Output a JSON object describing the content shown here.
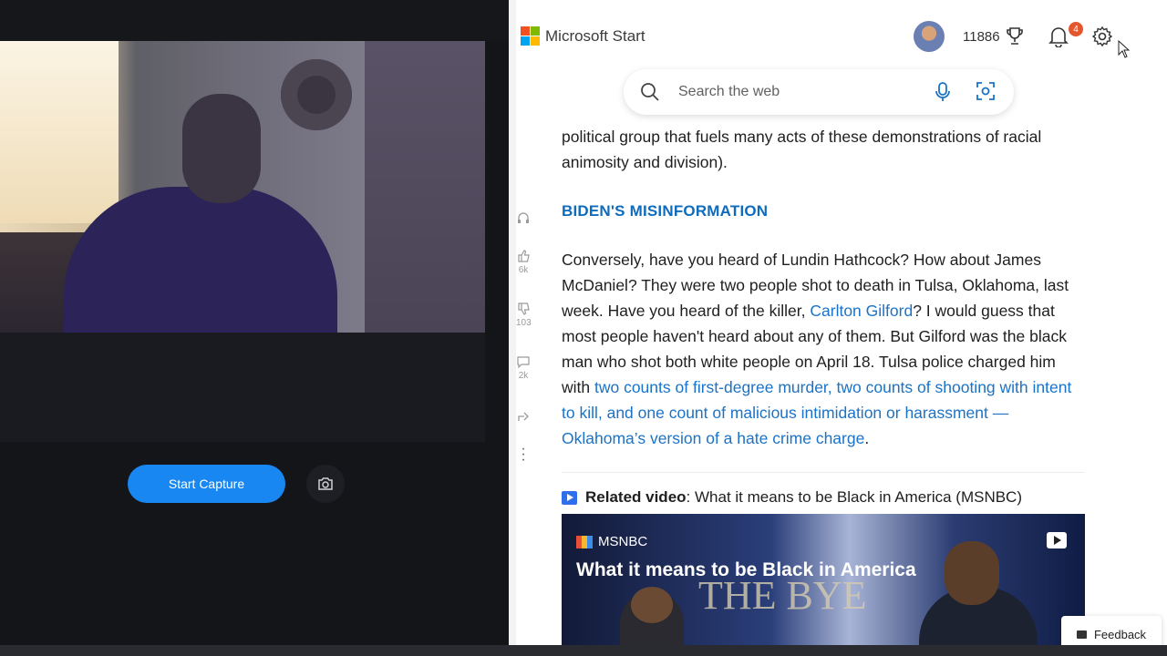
{
  "capture": {
    "start_label": "Start Capture"
  },
  "header": {
    "brand": "Microsoft Start",
    "points": "11886",
    "notification_count": "4",
    "brand_colors": [
      "#f25022",
      "#7fba00",
      "#00a4ef",
      "#ffb900"
    ]
  },
  "search": {
    "placeholder": "Search the web"
  },
  "rail": {
    "likes": "6k",
    "dislikes": "103",
    "comments": "2k"
  },
  "article": {
    "para_top": "political group that fuels many acts of these demonstrations of racial animosity and division).",
    "heading": "BIDEN'S MISINFORMATION",
    "para_part1": "Conversely, have you heard of Lundin Hathcock? How about James McDaniel? They were two people shot to death in Tulsa, Oklahoma, last week. Have you heard of the killer, ",
    "link1": "Carlton Gilford",
    "para_part2": "? I would guess that most people haven't heard about any of them. But Gilford was the black man who shot both white people on April 18. Tulsa police charged him with ",
    "link2": "two counts of first-degree murder, two counts of shooting with intent to kill, and one count of malicious intimidation or harassment — Oklahoma’s version of a hate crime charge",
    "para_end": "."
  },
  "related": {
    "label": "Related video",
    "text": ": What it means to be Black in America (MSNBC)"
  },
  "video": {
    "source": "MSNBC",
    "title": "What it means to be Black in America",
    "overlay_text": "THE BYE"
  },
  "feedback": {
    "label": "Feedback"
  },
  "colors": {
    "accent_blue": "#1887f2",
    "link_blue": "#1a73c8",
    "heading_blue": "#0f6cbd",
    "badge_orange": "#e4572e"
  }
}
